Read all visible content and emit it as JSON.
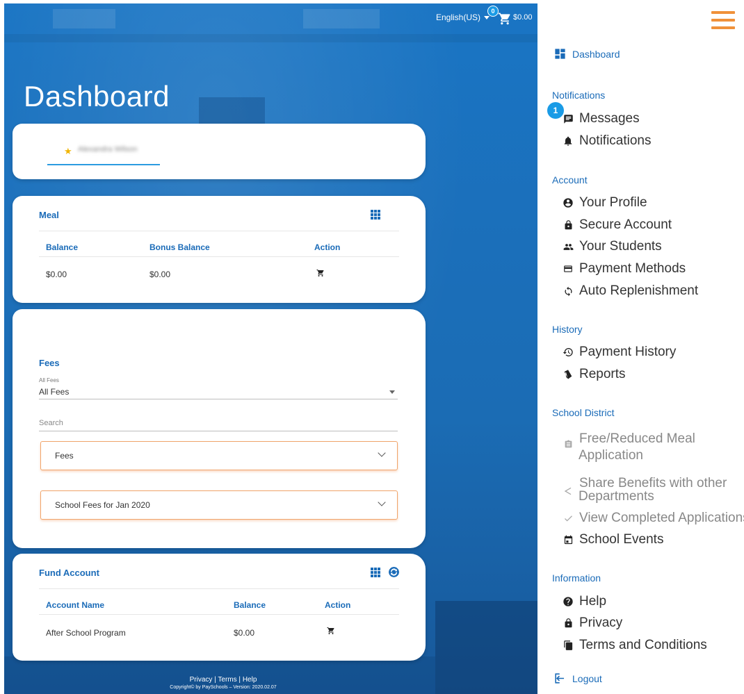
{
  "header": {
    "language": "English(US)",
    "cart_count": "0",
    "cart_total": "$0.00"
  },
  "page_title": "Dashboard",
  "student": {
    "name": "Alexandra Wilson"
  },
  "meal": {
    "title": "Meal",
    "columns": [
      "Balance",
      "Bonus Balance",
      "Action"
    ],
    "row": {
      "balance": "$0.00",
      "bonus_balance": "$0.00"
    }
  },
  "fees": {
    "title": "Fees",
    "filter_label": "All Fees",
    "filter_value": "All Fees",
    "search_placeholder": "Search",
    "groups": [
      "Fees",
      "School Fees for Jan 2020"
    ]
  },
  "fund_account": {
    "title": "Fund Account",
    "columns": [
      "Account Name",
      "Balance",
      "Action"
    ],
    "row": {
      "account_name": "After School Program",
      "balance": "$0.00"
    }
  },
  "footer": {
    "privacy": "Privacy",
    "terms": "Terms",
    "help": "Help",
    "sep": "|",
    "copyright": "Copyright© by PaySchools – Version: 2020.02.07"
  },
  "sidebar": {
    "dashboard": "Dashboard",
    "sections": {
      "notifications": "Notifications",
      "account": "Account",
      "history": "History",
      "school_district": "School District",
      "information": "Information"
    },
    "message_badge": "1",
    "items": {
      "messages": "Messages",
      "notifications": "Notifications",
      "your_profile": "Your Profile",
      "secure_account": "Secure Account",
      "your_students": "Your Students",
      "payment_methods": "Payment Methods",
      "auto_replenishment": "Auto Replenishment",
      "payment_history": "Payment History",
      "reports": "Reports",
      "free_reduced_1": "Free/Reduced Meal",
      "free_reduced_2": "Application",
      "share_benefits_1": "Share Benefits with other",
      "share_benefits_2": "Departments",
      "view_completed": "View Completed Applications",
      "school_events": "School Events",
      "help": "Help",
      "privacy": "Privacy",
      "terms": "Terms and Conditions"
    },
    "logout": "Logout"
  },
  "colors": {
    "brand_blue": "#1a6bb8",
    "accent_orange": "#f0913a",
    "badge_blue": "#1a9be6"
  },
  "icons": [
    "cart-icon",
    "grid-icon",
    "refresh-circle-icon",
    "star-icon",
    "hamburger-menu-icon",
    "dashboard-icon",
    "message-icon",
    "bell-icon",
    "profile-icon",
    "lock-icon",
    "students-icon",
    "credit-card-icon",
    "sync-icon",
    "history-icon",
    "reports-icon",
    "clipboard-icon",
    "share-icon",
    "check-icon",
    "calendar-icon",
    "help-icon",
    "document-icon",
    "logout-icon"
  ]
}
